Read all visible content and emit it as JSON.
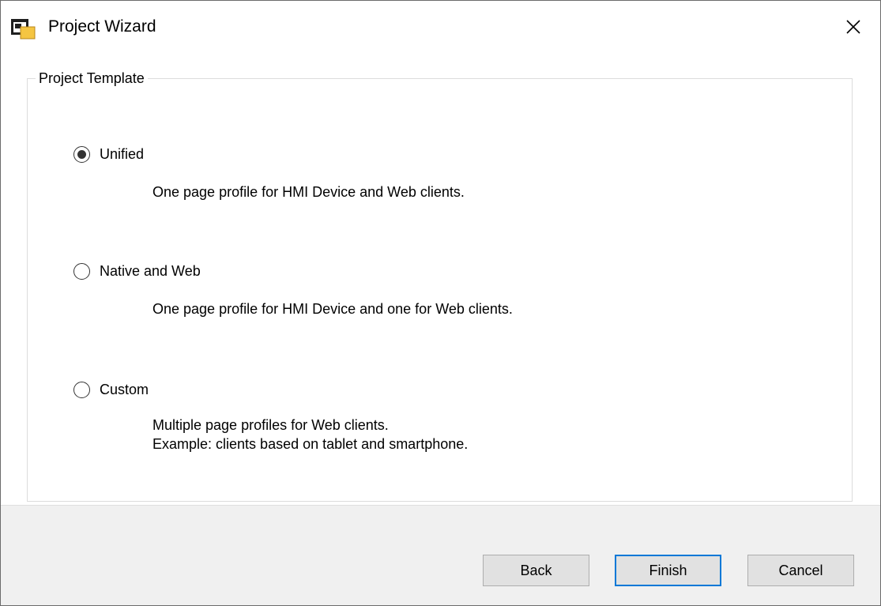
{
  "window": {
    "title": "Project Wizard",
    "app_icon": "project-wizard-app-icon",
    "close_icon": "close-icon"
  },
  "group": {
    "legend": "Project Template"
  },
  "options": [
    {
      "label": "Unified",
      "selected": true,
      "description": [
        "One page profile for HMI Device and Web clients."
      ]
    },
    {
      "label": "Native and Web",
      "selected": false,
      "description": [
        "One page profile for HMI Device and one for Web clients."
      ]
    },
    {
      "label": "Custom",
      "selected": false,
      "description": [
        "Multiple page profiles for Web clients.",
        "Example: clients based on tablet and smartphone."
      ]
    }
  ],
  "buttons": {
    "back": "Back",
    "finish": "Finish",
    "cancel": "Cancel"
  },
  "colors": {
    "default_button_border": "#0078d7",
    "footer_background": "#f0f0f0",
    "button_background": "#e1e1e1"
  }
}
